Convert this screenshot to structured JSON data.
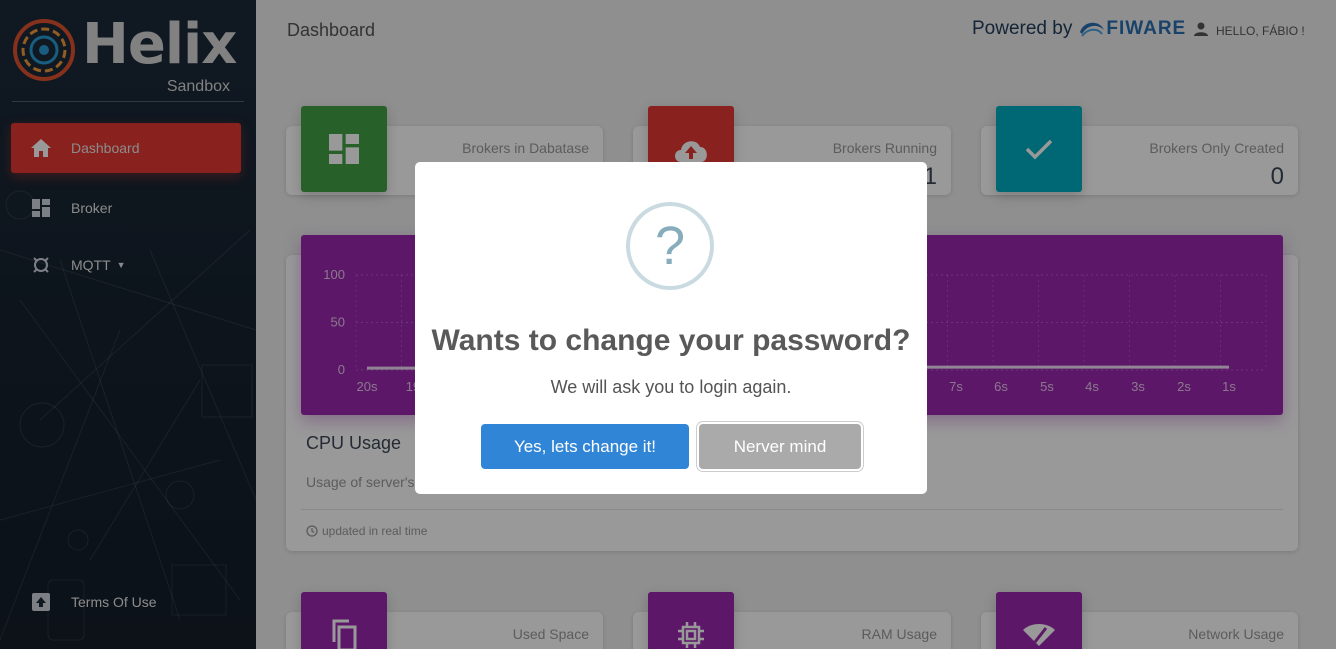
{
  "app": {
    "logo_text": "Helix",
    "logo_sub": "Sandbox"
  },
  "sidebar": {
    "items": [
      {
        "label": "Dashboard",
        "icon": "home-icon",
        "active": true
      },
      {
        "label": "Broker",
        "icon": "dashboard-icon",
        "active": false
      },
      {
        "label": "MQTT",
        "icon": "device-hub-icon",
        "active": false,
        "has_dropdown": true
      }
    ],
    "footer_item": {
      "label": "Terms Of Use",
      "icon": "upload-icon"
    }
  },
  "header": {
    "title": "Dashboard",
    "powered_by": "Powered by",
    "powered_brand": "FIWARE",
    "user_greeting": "HELLO, FÁBIO !"
  },
  "stats_top": [
    {
      "label": "Brokers in Dabatase",
      "value": "",
      "color": "#43a047",
      "icon": "dashboard-icon"
    },
    {
      "label": "Brokers Running",
      "value": "1",
      "color": "#e53935",
      "icon": "cloud-upload-icon"
    },
    {
      "label": "Brokers Only Created",
      "value": "0",
      "color": "#00acc1",
      "icon": "check-icon"
    }
  ],
  "chart_card": {
    "title": "CPU Usage",
    "subtitle": "Usage of server's",
    "footer": "updated in real time"
  },
  "chart_data": {
    "type": "line",
    "yticks": [
      "100",
      "50",
      "0"
    ],
    "ylim": [
      0,
      100
    ],
    "x_labels": [
      "20s",
      "19",
      "7s",
      "6s",
      "5s",
      "4s",
      "3s",
      "2s",
      "1s"
    ],
    "series": [
      {
        "values": [
          2,
          2,
          3,
          3,
          3,
          3,
          3,
          3,
          3
        ]
      }
    ],
    "grid": true,
    "background": "#9c27b0"
  },
  "stats_bottom": [
    {
      "label": "Used Space",
      "color": "#9c27b0",
      "icon": "copy-icon"
    },
    {
      "label": "RAM Usage",
      "color": "#9c27b0",
      "icon": "memory-chip-icon"
    },
    {
      "label": "Network Usage",
      "color": "#9c27b0",
      "icon": "wifi-icon"
    }
  ],
  "modal": {
    "icon": "question-icon",
    "icon_glyph": "?",
    "title": "Wants to change your password?",
    "message": "We will ask you to login again.",
    "confirm_label": "Yes, lets change it!",
    "cancel_label": "Nerver mind"
  }
}
